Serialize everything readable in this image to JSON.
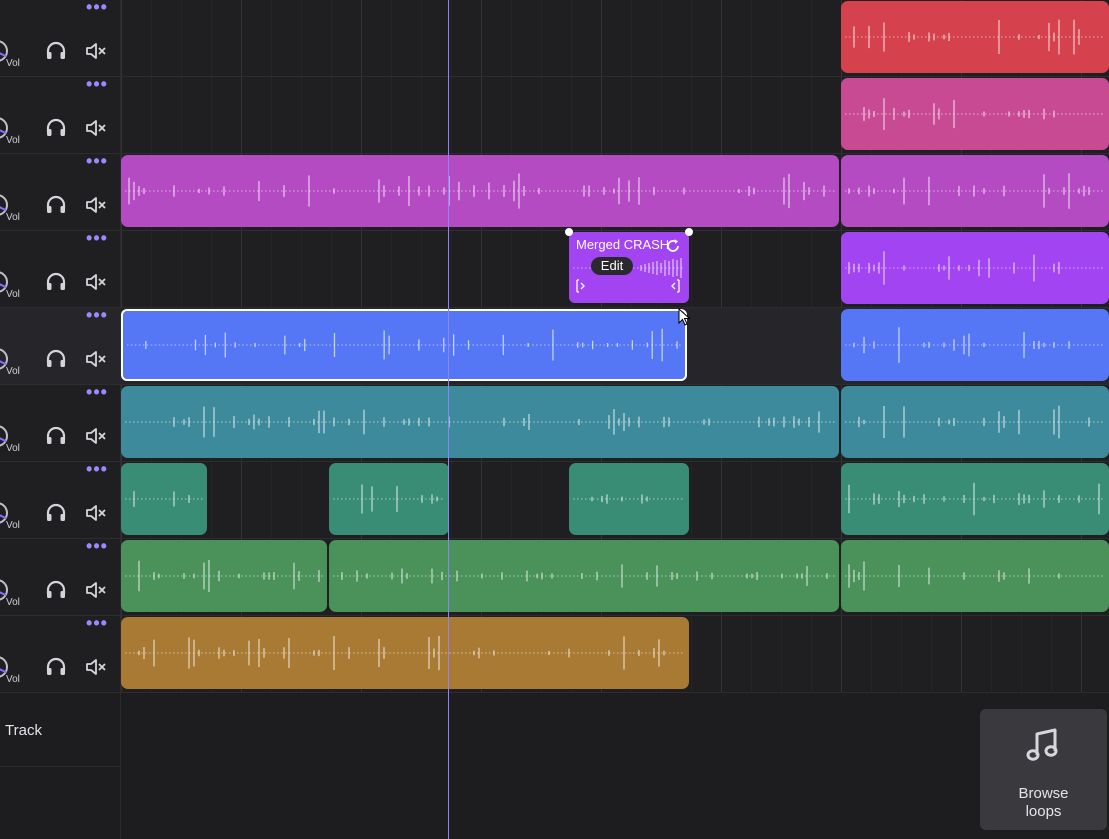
{
  "track_controls": {
    "more_glyph": "•••",
    "vol_label": "Vol"
  },
  "tracks": [
    {
      "color": "#d5424e",
      "clips": [
        {
          "start": 6.0,
          "end": 8.6
        }
      ]
    },
    {
      "color": "#c84a93",
      "clips": [
        {
          "start": 6.0,
          "end": 8.6
        }
      ]
    },
    {
      "color": "#b54bc2",
      "clips": [
        {
          "start": 0.0,
          "end": 5.98
        },
        {
          "start": 6.0,
          "end": 8.6
        }
      ]
    },
    {
      "color": "#a344f2",
      "clips": [
        {
          "start": 6.0,
          "end": 8.6
        }
      ]
    },
    {
      "color": "#5576f5",
      "clips": [
        {
          "start": 0.0,
          "end": 4.72,
          "selected": true
        },
        {
          "start": 6.0,
          "end": 8.6
        }
      ]
    },
    {
      "color": "#3d8a9c",
      "clips": [
        {
          "start": 0.0,
          "end": 5.98
        },
        {
          "start": 6.0,
          "end": 8.6
        }
      ]
    },
    {
      "color": "#3a8d75",
      "clips": [
        {
          "start": 0.0,
          "end": 0.72
        },
        {
          "start": 1.73,
          "end": 2.73
        },
        {
          "start": 3.73,
          "end": 4.73
        },
        {
          "start": 6.0,
          "end": 8.6
        }
      ]
    },
    {
      "color": "#4a915a",
      "clips": [
        {
          "start": 0.0,
          "end": 1.72
        },
        {
          "start": 1.73,
          "end": 5.98
        },
        {
          "start": 6.0,
          "end": 8.6
        }
      ]
    },
    {
      "color": "#a87a33",
      "clips": [
        {
          "start": 0.0,
          "end": 4.73
        }
      ]
    }
  ],
  "merged_clip": {
    "title": "Merged CRASH",
    "edit_label": "Edit"
  },
  "add_track": {
    "label": "Track"
  },
  "browse_loops": {
    "line1": "Browse",
    "line2": "loops",
    "icon": "music-note-icon"
  },
  "playhead_position": 2.73
}
